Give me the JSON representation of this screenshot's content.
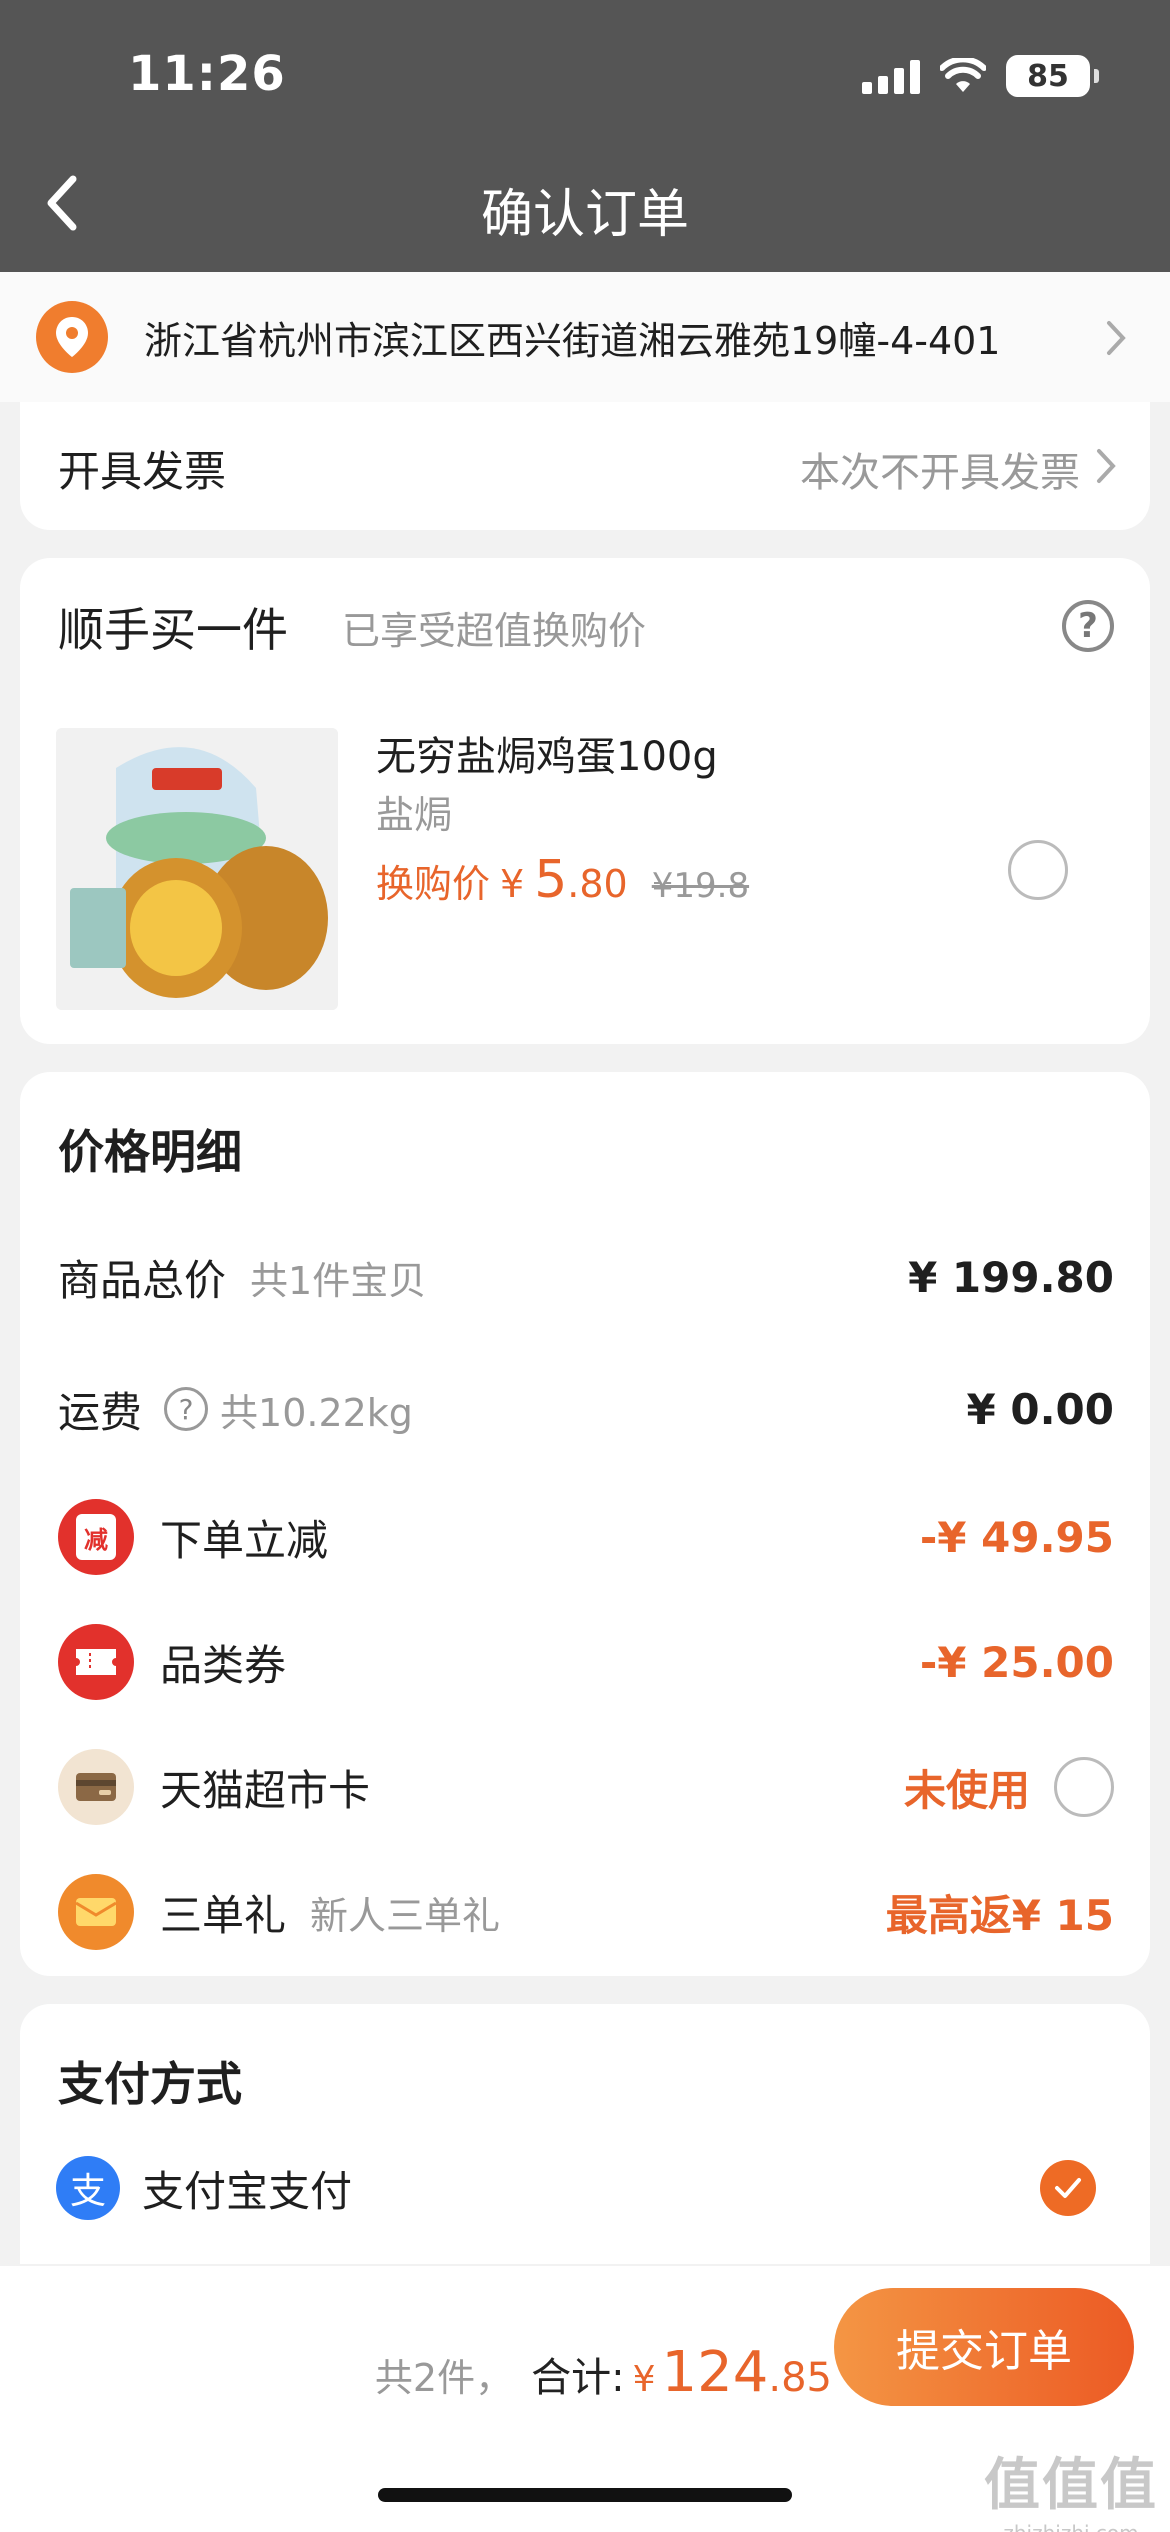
{
  "status_bar": {
    "time": "11:26",
    "battery": "85"
  },
  "nav": {
    "title": "确认订单"
  },
  "address": {
    "text": "浙江省杭州市滨江区西兴街道湘云雅苑19幢-4-401"
  },
  "invoice": {
    "label": "开具发票",
    "value": "本次不开具发票"
  },
  "addon": {
    "title": "顺手买一件",
    "subtitle": "已享受超值换购价",
    "product": {
      "name": "无穷盐焗鸡蛋100g",
      "variant": "盐焗",
      "price_label": "换购价",
      "currency": "¥",
      "price_int": "5",
      "price_dec": ".80",
      "original_price": "¥19.8"
    }
  },
  "price_detail": {
    "title": "价格明细",
    "goods_total": {
      "label": "商品总价",
      "sub": "共1件宝贝",
      "amount": "¥ 199.80"
    },
    "shipping": {
      "label": "运费",
      "sub": "共10.22kg",
      "amount": "¥ 0.00"
    },
    "order_discount": {
      "label": "下单立减",
      "icon_char": "减",
      "amount": "-¥ 49.95"
    },
    "category_coupon": {
      "label": "品类券",
      "amount": "-¥ 25.00"
    },
    "tmall_card": {
      "label": "天猫超市卡",
      "status": "未使用"
    },
    "three_order_gift": {
      "label": "三单礼",
      "sub": "新人三单礼",
      "amount": "最高返¥ 15"
    }
  },
  "payment": {
    "title": "支付方式",
    "method": "支付宝支付",
    "icon_char": "支"
  },
  "bottom_bar": {
    "count": "共2件，",
    "total_label": "合计:",
    "currency": "¥",
    "total_int": "124",
    "total_dec": ".85",
    "submit": "提交订单"
  },
  "watermark": {
    "glyph": "值值值",
    "url": "zhizhizhi.com"
  },
  "colors": {
    "accent": "#e8652b",
    "header": "#555555",
    "alipay": "#2f7df6"
  }
}
